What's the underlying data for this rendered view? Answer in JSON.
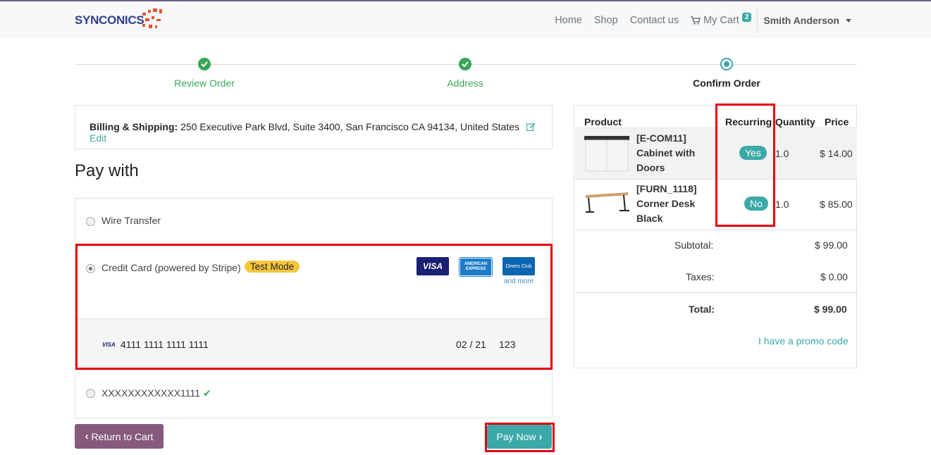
{
  "nav": {
    "brand": "SYNCONICS",
    "home": "Home",
    "shop": "Shop",
    "contact": "Contact us",
    "cart_label": "My Cart",
    "cart_count": "2",
    "user": "Smith Anderson"
  },
  "steps": [
    {
      "label": "Review Order",
      "state": "done"
    },
    {
      "label": "Address",
      "state": "done"
    },
    {
      "label": "Confirm Order",
      "state": "current"
    }
  ],
  "billing": {
    "label": "Billing & Shipping:",
    "address": "250 Executive Park Blvd, Suite 3400, San Francisco CA 94134, United States",
    "edit": "Edit"
  },
  "pay_with": "Pay with",
  "payment": {
    "wire": "Wire Transfer",
    "stripe": "Credit Card (powered by Stripe)",
    "test_mode": "Test Mode",
    "logos": [
      "VISA",
      "AMERICAN EXPRESS",
      "Diners Club"
    ],
    "and_more": "and more",
    "card_brand": "VISA",
    "card_number": "4111 1111 1111 1111",
    "expiry": "02 / 21",
    "cvc": "123",
    "saved_card": "XXXXXXXXXXXX1111"
  },
  "buttons": {
    "return": "Return to Cart",
    "pay": "Pay Now"
  },
  "summary": {
    "headers": {
      "product": "Product",
      "recurring": "Recurring",
      "quantity": "Quantity",
      "price": "Price"
    },
    "items": [
      {
        "name": "[E-COM11] Cabinet with Doors",
        "recurring": "Yes",
        "quantity": "1.0",
        "price": "$ 14.00"
      },
      {
        "name": "[FURN_1118] Corner Desk Black",
        "recurring": "No",
        "quantity": "1.0",
        "price": "$ 85.00"
      }
    ],
    "subtotal_label": "Subtotal:",
    "subtotal": "$ 99.00",
    "taxes_label": "Taxes:",
    "taxes": "$ 0.00",
    "total_label": "Total:",
    "total": "$ 99.00",
    "promo": "I have a promo code"
  },
  "colors": {
    "accent": "#3aa9a7",
    "brand": "#875a7b",
    "success": "#38a857",
    "highlight": "#e5000e",
    "badge": "#f7c63d"
  }
}
